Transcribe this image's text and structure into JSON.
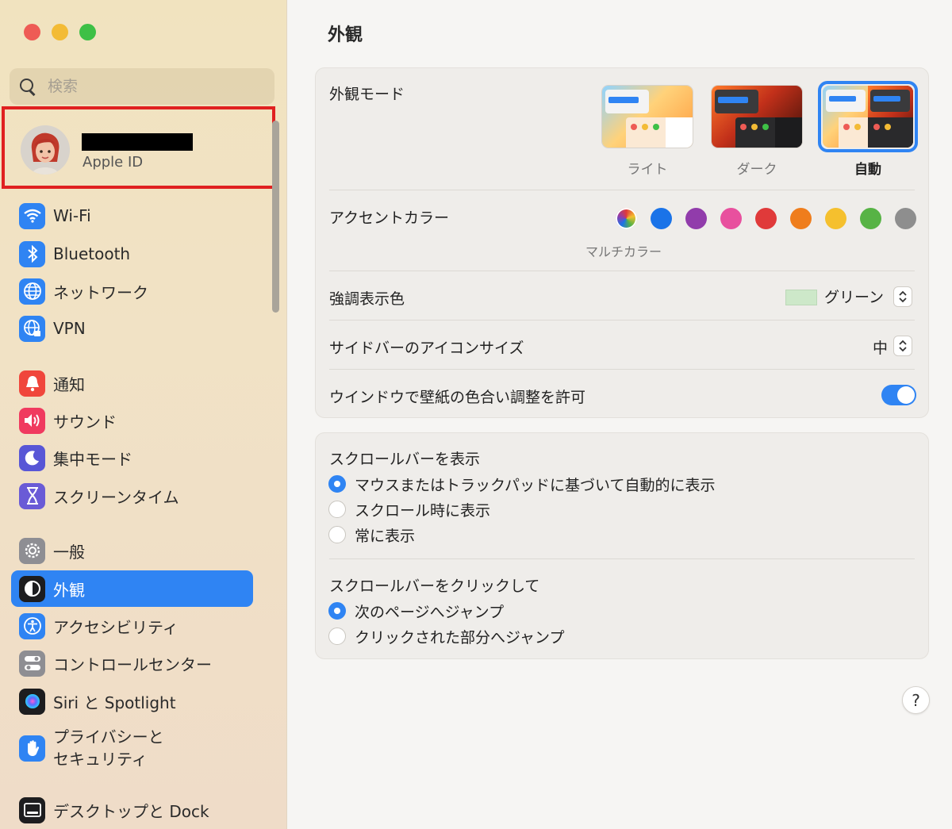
{
  "window": {
    "title": "外観"
  },
  "search": {
    "placeholder": "検索"
  },
  "apple_id": {
    "label": "Apple ID"
  },
  "sidebar": {
    "items": [
      {
        "label": "Wi-Fi",
        "icon": "wifi-icon",
        "color": "#2f84f3"
      },
      {
        "label": "Bluetooth",
        "icon": "bluetooth-icon",
        "color": "#2f84f3"
      },
      {
        "label": "ネットワーク",
        "icon": "globe-icon",
        "color": "#2f84f3"
      },
      {
        "label": "VPN",
        "icon": "vpn-icon",
        "color": "#2f84f3"
      },
      {
        "label": "通知",
        "icon": "bell-icon",
        "color": "#f0463b"
      },
      {
        "label": "サウンド",
        "icon": "speaker-icon",
        "color": "#f03a5f"
      },
      {
        "label": "集中モード",
        "icon": "moon-icon",
        "color": "#5856d6"
      },
      {
        "label": "スクリーンタイム",
        "icon": "hourglass-icon",
        "color": "#6a5bd6"
      },
      {
        "label": "一般",
        "icon": "gear-icon",
        "color": "#8e8e93"
      },
      {
        "label": "外観",
        "icon": "appearance-icon",
        "color": "#1d1d1f"
      },
      {
        "label": "アクセシビリティ",
        "icon": "accessibility-icon",
        "color": "#2f84f3"
      },
      {
        "label": "コントロールセンター",
        "icon": "control-center-icon",
        "color": "#8e8e93"
      },
      {
        "label": "Siri と Spotlight",
        "icon": "siri-icon",
        "color": "#1d1d1f"
      },
      {
        "label_line1": "プライバシーと",
        "label_line2": "セキュリティ",
        "icon": "hand-icon",
        "color": "#2f84f3"
      },
      {
        "label": "デスクトップと Dock",
        "icon": "dock-icon",
        "color": "#1d1d1f"
      }
    ]
  },
  "appearance": {
    "mode_label": "外観モード",
    "modes": [
      {
        "label": "ライト"
      },
      {
        "label": "ダーク"
      },
      {
        "label": "自動"
      }
    ],
    "selected_mode": "自動",
    "accent_label": "アクセントカラー",
    "accent_colors": [
      "multicolor",
      "#1a73e8",
      "#913cab",
      "#e8509e",
      "#e03a3a",
      "#ef7d1c",
      "#f5c02e",
      "#57b345",
      "#8e8e8e"
    ],
    "accent_selected_caption": "マルチカラー",
    "highlight_label": "強調表示色",
    "highlight_value": "グリーン",
    "highlight_color": "#cde8c9",
    "icon_size_label": "サイドバーのアイコンサイズ",
    "icon_size_value": "中",
    "tint_label": "ウインドウで壁紙の色合い調整を許可",
    "tint_enabled": true
  },
  "scrollbars": {
    "show_label": "スクロールバーを表示",
    "show_options": [
      {
        "label": "マウスまたはトラックパッドに基づいて自動的に表示",
        "selected": true
      },
      {
        "label": "スクロール時に表示",
        "selected": false
      },
      {
        "label": "常に表示",
        "selected": false
      }
    ],
    "click_label": "スクロールバーをクリックして",
    "click_options": [
      {
        "label": "次のページへジャンプ",
        "selected": true
      },
      {
        "label": "クリックされた部分へジャンプ",
        "selected": false
      }
    ]
  },
  "help": {
    "label": "?"
  }
}
